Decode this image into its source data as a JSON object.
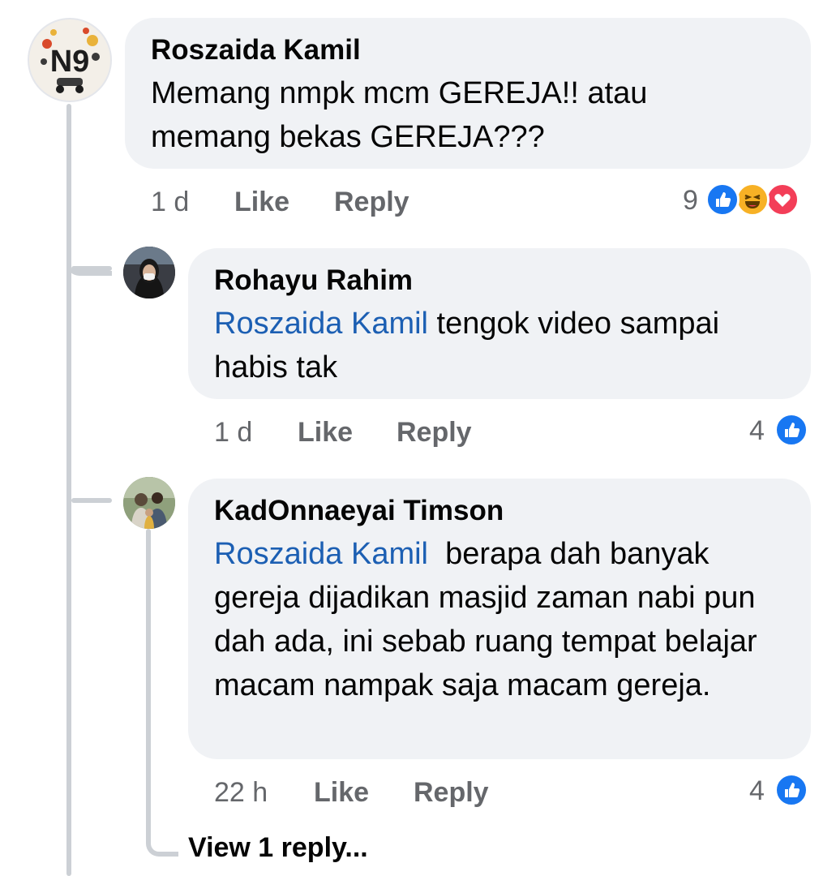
{
  "comments": [
    {
      "author": "Roszaida Kamil",
      "text": "Memang nmpk mcm GEREJA!! atau memang bekas GEREJA???",
      "time": "1 d",
      "like_label": "Like",
      "reply_label": "Reply",
      "reaction_count": "9",
      "reactions": [
        "like-reaction-icon",
        "haha-reaction-icon",
        "love-reaction-icon"
      ]
    }
  ],
  "replies": [
    {
      "author": "Rohayu Rahim",
      "mention": "Roszaida Kamil",
      "text": " tengok video sampai habis tak",
      "time": "1 d",
      "like_label": "Like",
      "reply_label": "Reply",
      "reaction_count": "4",
      "reactions": [
        "like-reaction-icon"
      ]
    },
    {
      "author": "KadOnnaeyai Timson",
      "mention": "Roszaida Kamil",
      "text": "  berapa dah banyak gereja dijadikan masjid zaman nabi pun dah ada, ini sebab ruang tempat belajar macam nampak saja macam gereja.",
      "time": "22 h",
      "like_label": "Like",
      "reply_label": "Reply",
      "reaction_count": "4",
      "reactions": [
        "like-reaction-icon"
      ],
      "view_replies_label": "View 1 reply..."
    }
  ],
  "colors": {
    "bubble": "#f0f2f5",
    "mention": "#1c5fb3",
    "meta": "#65676b",
    "like_blue": "#1877f2",
    "love_red": "#f33e58",
    "haha_yellow": "#f7b125"
  }
}
